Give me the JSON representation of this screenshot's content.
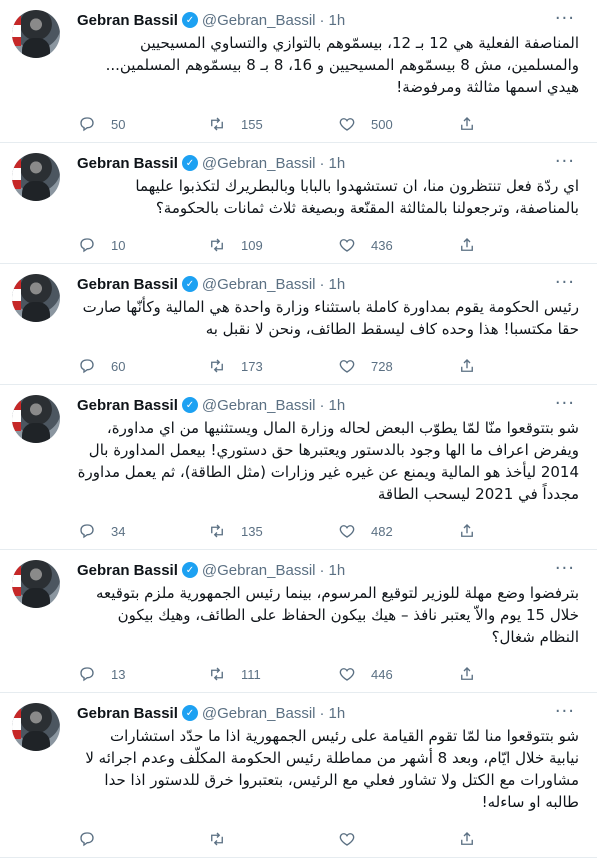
{
  "icons": {
    "verified": "verified-badge-icon",
    "more": "more-dots-icon",
    "reply": "reply-icon",
    "retweet": "retweet-icon",
    "like": "like-icon",
    "share": "share-icon"
  },
  "colors": {
    "accent": "#1da1f2",
    "muted": "#5b7083",
    "divider": "#e6ecf0"
  },
  "tweets": [
    {
      "name": "Gebran Bassil",
      "handle": "@Gebran_Bassil",
      "dot": "·",
      "time": "1h",
      "text": "المناصفة الفعلية هي 12 بـ 12، بيسمّوهم بالتوازي والتساوي المسيحيين والمسلمين، مش 8 بيسمّوهم المسيحيين و 16، 8 بـ 8 بيسمّوهم المسلمين... هيدي اسمها مثالثة ومرفوضة!",
      "replies": "50",
      "retweets": "155",
      "likes": "500"
    },
    {
      "name": "Gebran Bassil",
      "handle": "@Gebran_Bassil",
      "dot": "·",
      "time": "1h",
      "text": "اي ردّة فعل تنتظرون منا، ان تستشهدوا بالبابا وبالبطريرك لتكذبوا عليهما بالمناصفة، وترجعولنا بالمثالثة المقنّعة وبصيغة ثلاث ثمانات بالحكومة؟",
      "replies": "10",
      "retweets": "109",
      "likes": "436"
    },
    {
      "name": "Gebran Bassil",
      "handle": "@Gebran_Bassil",
      "dot": "·",
      "time": "1h",
      "text": "رئيس الحكومة يقوم بمداورة كاملة باستثناء وزارة واحدة هي المالية وكأنّها صارت حقا مكتسبا! هذا وحده كاف ليسقط الطائف، ونحن لا نقبل به",
      "replies": "60",
      "retweets": "173",
      "likes": "728"
    },
    {
      "name": "Gebran Bassil",
      "handle": "@Gebran_Bassil",
      "dot": "·",
      "time": "1h",
      "text": "شو بتتوقعوا منّا لمّا يطوّب البعض لحاله وزارة المال ويستثنيها من اي مداورة، ويفرض اعراف ما الها وجود بالدستور ويعتبرها حق دستوري! بيعمل المداورة بال 2014 ليأخذ هو المالية ويمنع عن غيره غير وزارات (مثل الطاقة)، ثم يعمل مداورة مجدداً في 2021 ليسحب الطاقة",
      "replies": "34",
      "retweets": "135",
      "likes": "482"
    },
    {
      "name": "Gebran Bassil",
      "handle": "@Gebran_Bassil",
      "dot": "·",
      "time": "1h",
      "text": "بترفضوا وضع مهلة للوزير لتوقيع المرسوم، بينما رئيس الجمهورية ملزم بتوقيعه خلال 15 يوم والاّ يعتبر نافذ – هيك بيكون الحفاظ على الطائف، وهيك بيكون النظام شغال؟",
      "replies": "13",
      "retweets": "111",
      "likes": "446"
    },
    {
      "name": "Gebran Bassil",
      "handle": "@Gebran_Bassil",
      "dot": "·",
      "time": "1h",
      "text": "شو بتتوقعوا منا لمّا تقوم القيامة على رئيس الجمهورية اذا ما حدّد استشارات نيابية خلال ايّام، وبعد 8 أشهر من مماطلة رئيس الحكومة المكلّف وعدم اجرائه لا مشاورات مع الكتل ولا تشاور فعلي مع الرئيس، بتعتبروا خرق للدستور اذا حدا طالبه او ساءله!",
      "replies": "",
      "retweets": "",
      "likes": ""
    }
  ]
}
